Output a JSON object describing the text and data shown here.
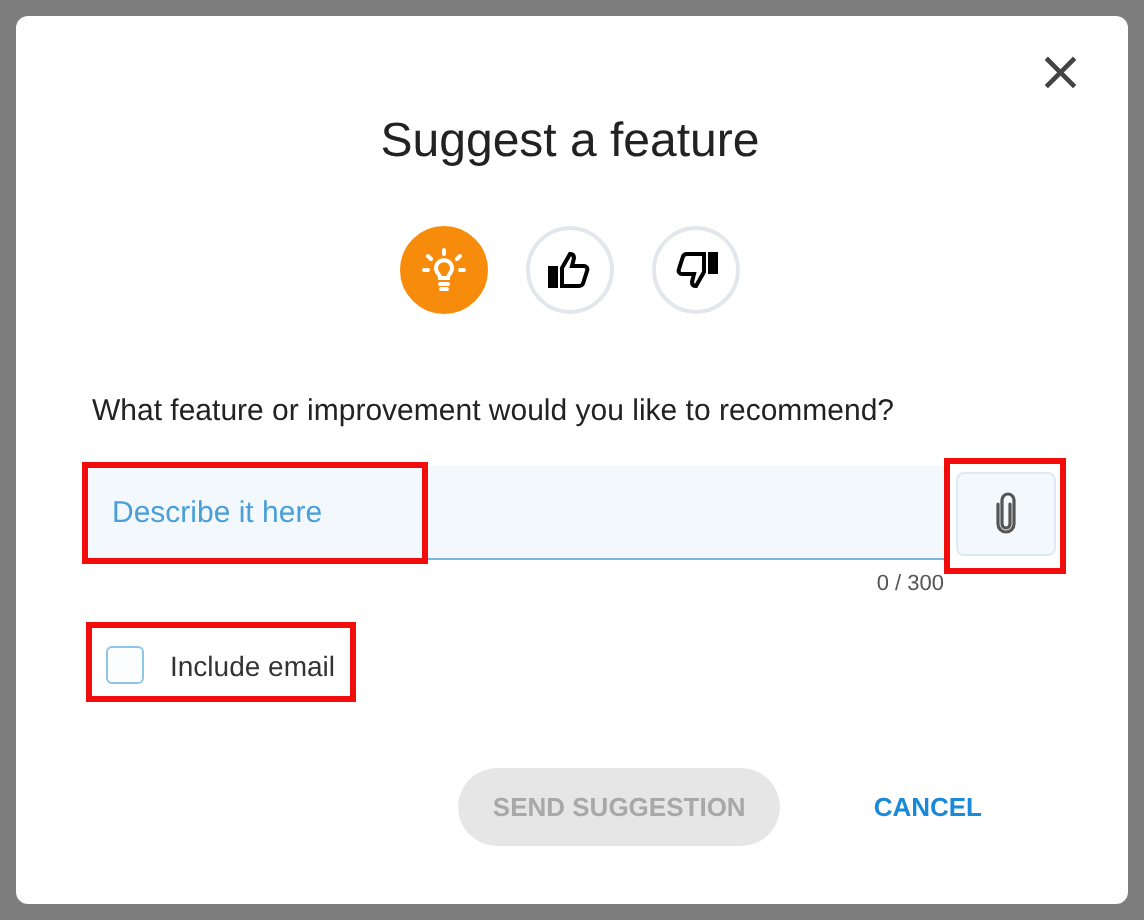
{
  "dialog": {
    "title": "Suggest a feature",
    "close": "×"
  },
  "feedback_types": [
    {
      "kind": "idea",
      "selected": true
    },
    {
      "kind": "like",
      "selected": false
    },
    {
      "kind": "dislike",
      "selected": false
    }
  ],
  "question": "What feature or improvement would you like to recommend?",
  "field": {
    "placeholder": "Describe it here",
    "counter": "0 / 300",
    "highlighted": true
  },
  "attach": {
    "highlighted": true
  },
  "include_email": {
    "label": "Include email",
    "checked": false,
    "highlighted": true
  },
  "buttons": [
    {
      "kind": "primary",
      "label": "SEND SUGGESTION",
      "disabled": true
    },
    {
      "kind": "text",
      "label": "CANCEL",
      "disabled": false
    }
  ]
}
